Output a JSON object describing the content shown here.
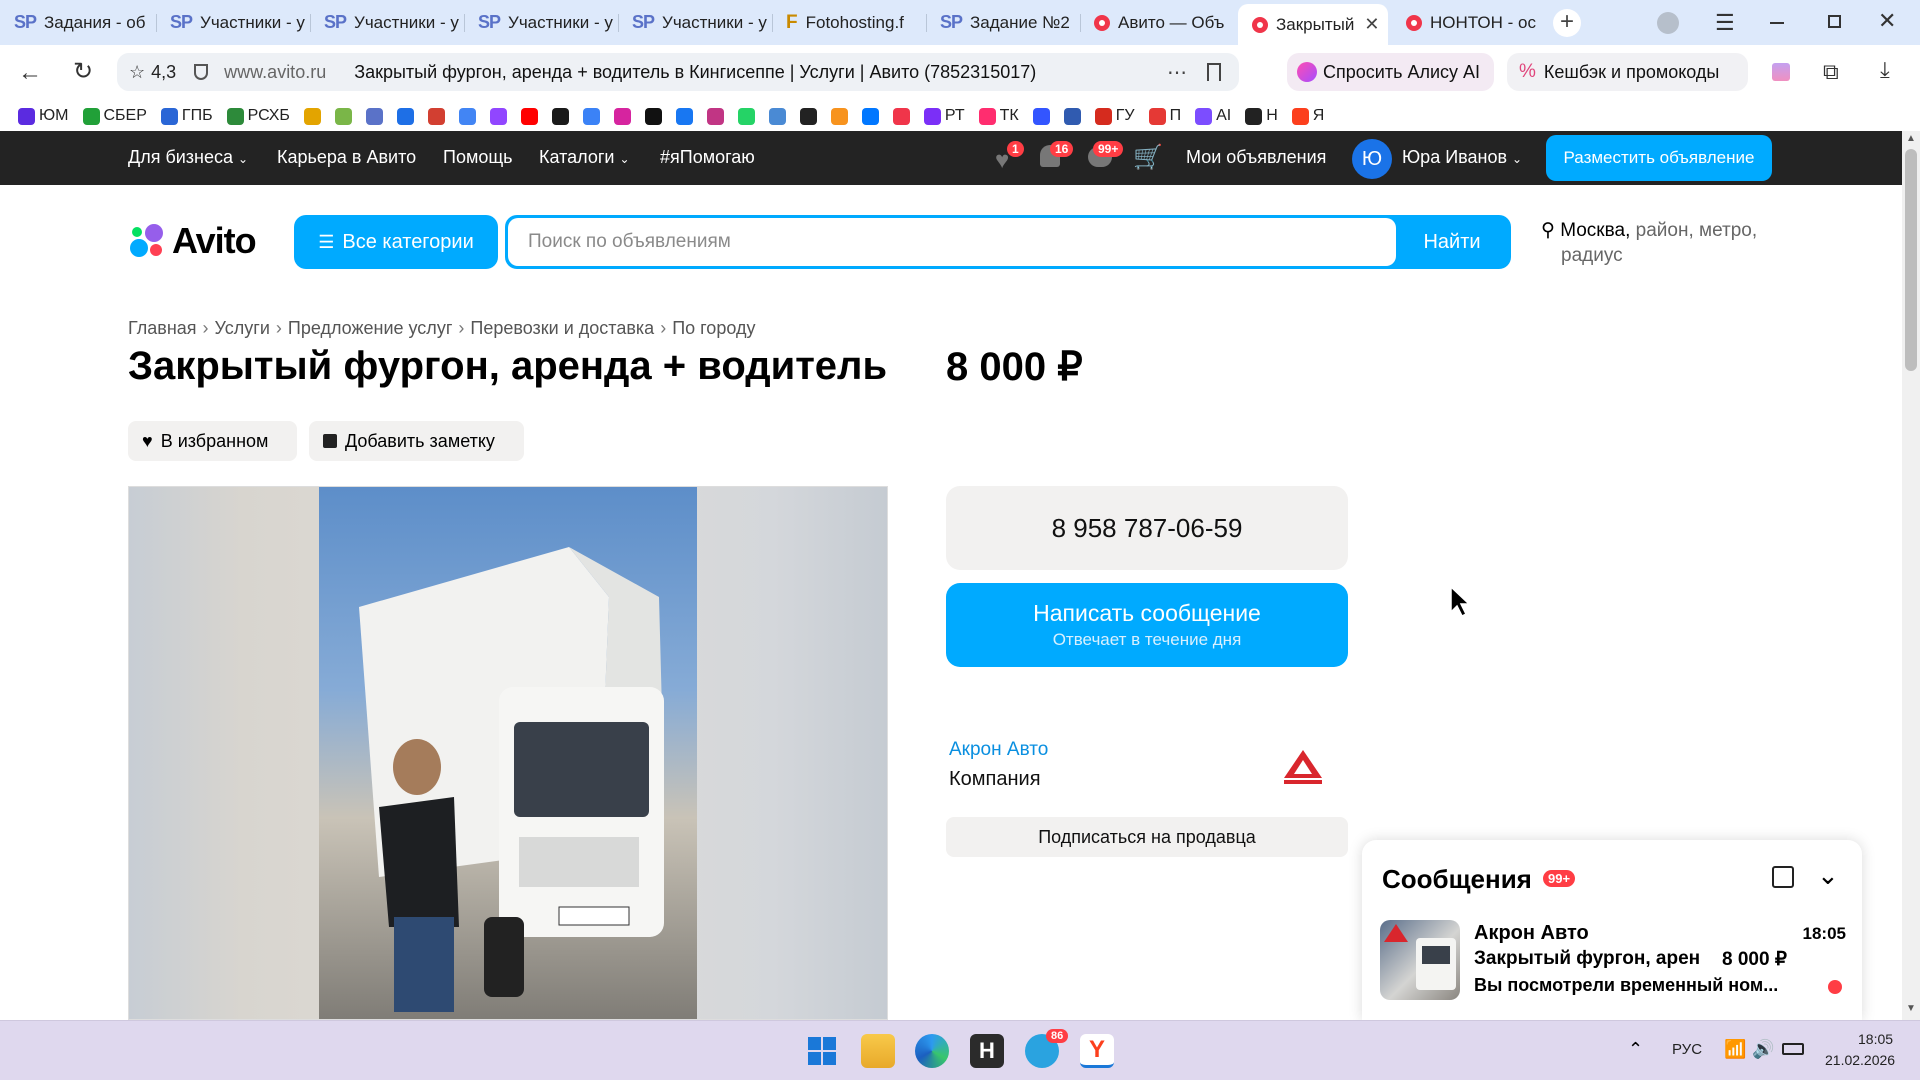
{
  "browser": {
    "tabs": [
      {
        "icon": "SP",
        "title": "Задания - об"
      },
      {
        "icon": "SP",
        "title": "Участники - у"
      },
      {
        "icon": "SP",
        "title": "Участники - у"
      },
      {
        "icon": "SP",
        "title": "Участники - у"
      },
      {
        "icon": "SP",
        "title": "Участники - у"
      },
      {
        "icon": "F",
        "title": "Fotohosting.f"
      },
      {
        "icon": "SP",
        "title": "Задание №2"
      },
      {
        "icon": "avito",
        "title": "Авито — Объ"
      },
      {
        "icon": "avito",
        "title": "Закрытый"
      },
      {
        "icon": "avito",
        "title": "НОНТОН - ос"
      }
    ],
    "rating": "4,3",
    "domain": "www.avito.ru",
    "page_title": "Закрытый фургон, аренда + водитель в Кингисеппе | Услуги | Авито (7852315017)",
    "alice_label": "Спросить Алису AI",
    "cashback_label": "Кешбэк и промокоды",
    "bookmarks": [
      {
        "label": "ЮМ",
        "color": "#5b2be0"
      },
      {
        "label": "СБЕР",
        "color": "#21a038"
      },
      {
        "label": "ГПБ",
        "color": "#2a66d6"
      },
      {
        "label": "РСХБ",
        "color": "#2d8a3a"
      },
      {
        "label": "",
        "color": "#e3a400"
      },
      {
        "label": "",
        "color": "#7ab648"
      },
      {
        "label": "",
        "color": "#5a72c8"
      },
      {
        "label": "",
        "color": "#1e6fe6"
      },
      {
        "label": "",
        "color": "#d23f31"
      },
      {
        "label": "",
        "color": "#4285f4"
      },
      {
        "label": "",
        "color": "#9146ff"
      },
      {
        "label": "",
        "color": "#ff0000"
      },
      {
        "label": "",
        "color": "#1a1a1a"
      },
      {
        "label": "",
        "color": "#3b82f6"
      },
      {
        "label": "",
        "color": "#d6249f"
      },
      {
        "label": "",
        "color": "#111111"
      },
      {
        "label": "",
        "color": "#1877f2"
      },
      {
        "label": "",
        "color": "#c13584"
      },
      {
        "label": "",
        "color": "#25d366"
      },
      {
        "label": "",
        "color": "#4a8ad4"
      },
      {
        "label": "",
        "color": "#222222"
      },
      {
        "label": "",
        "color": "#f7931e"
      },
      {
        "label": "",
        "color": "#0077ff"
      },
      {
        "label": "",
        "color": "#f0354a"
      },
      {
        "label": "РТ",
        "color": "#7b2ff7"
      },
      {
        "label": "ТК",
        "color": "#ff2d6f"
      },
      {
        "label": "",
        "color": "#3355ff"
      },
      {
        "label": "",
        "color": "#305bb0"
      },
      {
        "label": "ГУ",
        "color": "#d52b1e"
      },
      {
        "label": "П",
        "color": "#e53935"
      },
      {
        "label": "AI",
        "color": "#7c4dff"
      },
      {
        "label": "Н",
        "color": "#222222"
      },
      {
        "label": "Я",
        "color": "#fc3f1d"
      }
    ]
  },
  "site_header": {
    "nav": [
      "Для бизнеса",
      "Карьера в Авито",
      "Помощь",
      "Каталоги",
      "#яПомогаю"
    ],
    "favorites_count": "1",
    "notifications_count": "16",
    "messages_count": "99+",
    "my_ads": "Мои объявления",
    "user_initial": "Ю",
    "user_name": "Юра Иванов",
    "post_ad": "Разместить объявление"
  },
  "search": {
    "logo": "Avito",
    "categories_label": "Все категории",
    "placeholder": "Поиск по объявлениям",
    "find_label": "Найти",
    "location": "Москва,",
    "location_rest": "район, метро,",
    "location_rest2": "радиус"
  },
  "breadcrumbs": [
    "Главная",
    "Услуги",
    "Предложение услуг",
    "Перевозки и доставка",
    "По городу"
  ],
  "listing": {
    "title": "Закрытый фургон, аренда + водитель",
    "price": "8 000 ₽",
    "favorite_label": "В избранном",
    "note_label": "Добавить заметку"
  },
  "contact": {
    "phone": "8 958 787-06-59",
    "message_label": "Написать сообщение",
    "message_sub": "Отвечает в течение дня",
    "seller_name": "Акрон Авто",
    "seller_type": "Компания",
    "subscribe_label": "Подписаться на продавца"
  },
  "messenger": {
    "title": "Сообщения",
    "count": "99+",
    "chat": {
      "name": "Акрон Авто",
      "time": "18:05",
      "subject": "Закрытый фургон, арен...",
      "price": "8 000 ₽",
      "preview": "Вы посмотрели временный ном..."
    }
  },
  "taskbar": {
    "telegram_badge": "86",
    "language": "РУС",
    "time": "18:05",
    "date": "21.02.2026"
  },
  "colors": {
    "accent": "#00aaff",
    "header_bg": "#232323",
    "badge_red": "#ff3d44"
  }
}
